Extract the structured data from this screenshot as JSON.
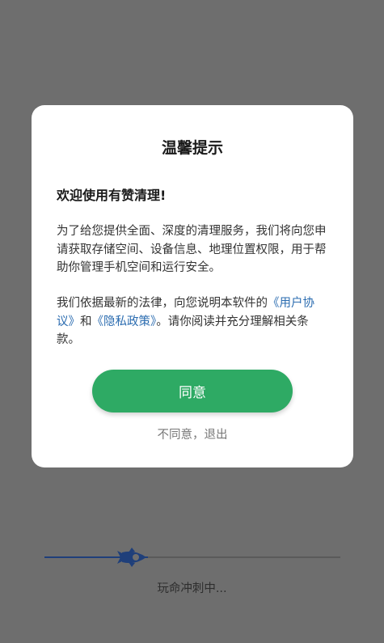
{
  "dialog": {
    "title": "温馨提示",
    "welcome": "欢迎使用有赞清理!",
    "paragraph1": "为了给您提供全面、深度的清理服务，我们将向您申请获取存储空间、设备信息、地理位置权限，用于帮助你管理手机空间和运行安全。",
    "paragraph2_prefix": "我们依据最新的法律，向您说明本软件的",
    "user_agreement_link": "《用户协议》",
    "paragraph2_and": "和",
    "privacy_policy_link": "《隐私政策》",
    "paragraph2_suffix": "。请你阅读并充分理解相关条款。",
    "agree_label": "同意",
    "disagree_label": "不同意，退出"
  },
  "loading": {
    "text": "玩命冲刺中...",
    "progress": 0.35,
    "icon": "rocket-icon",
    "bar_color": "#1f3f7a"
  },
  "colors": {
    "accent": "#2eaa64",
    "link": "#2b6cb0",
    "overlay": "#6e6e6e"
  }
}
